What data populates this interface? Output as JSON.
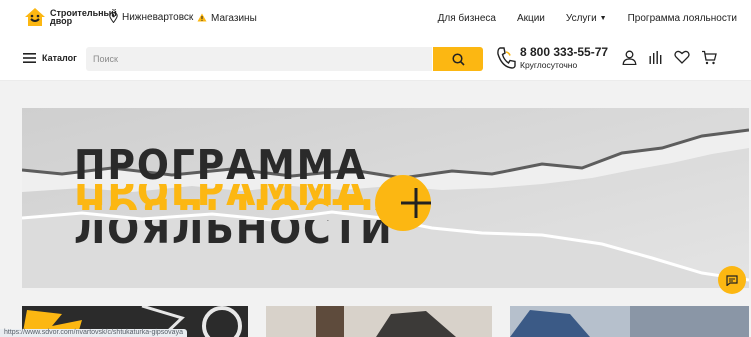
{
  "logo": {
    "text": "Строительный двор",
    "accent": "#fcb712"
  },
  "topbar": {
    "city": "Нижневартовск",
    "stores": "Магазины",
    "links": [
      "Для бизнеса",
      "Акции",
      "Услуги",
      "Программа лояльности"
    ]
  },
  "header": {
    "catalog_label": "Каталог",
    "search_placeholder": "Поиск",
    "phone": "8 800 333-55-77",
    "phone_hours": "Круглосуточно"
  },
  "banner": {
    "line1": "ПРОГРАММА",
    "line2": "ЛОЯЛЬНОСТИ"
  },
  "status": {
    "url": "https://www.sdvor.com/nvartovsk/c/shtukaturka-gipsovaya"
  },
  "colors": {
    "brand_yellow": "#fcb712",
    "text": "#222222"
  }
}
